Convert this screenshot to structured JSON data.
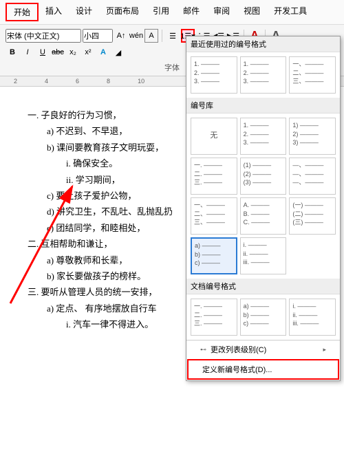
{
  "menubar": {
    "items": [
      "开始",
      "插入",
      "设计",
      "页面布局",
      "引用",
      "邮件",
      "审阅",
      "视图",
      "开发工具"
    ],
    "active_index": 0
  },
  "toolbar": {
    "font_name": "宋体 (中文正文)",
    "font_size": "小四",
    "font_group_label": "字体"
  },
  "ruler": {
    "marks": [
      "2",
      "4",
      "6",
      "8",
      "10"
    ]
  },
  "document": {
    "lines": [
      {
        "level": 1,
        "text": "一. 子良好的行为习惯，"
      },
      {
        "level": 2,
        "text": "a)  不迟到、不早退，"
      },
      {
        "level": 2,
        "text": "b)  课间要教育孩子文明玩耍，"
      },
      {
        "level": 3,
        "text": "i.   确保安全。"
      },
      {
        "level": 3,
        "text": "ii.   学习期间，"
      },
      {
        "level": 2,
        "text": "c)  要让孩子爱护公物，"
      },
      {
        "level": 2,
        "text": "d)  讲究卫生，不乱吐、乱抛乱扔"
      },
      {
        "level": 2,
        "text": "e)  团结同学，和睦相处，"
      },
      {
        "level": 1,
        "text": "二. 互相帮助和谦让，"
      },
      {
        "level": 2,
        "text": "a)  尊敬教师和长辈，"
      },
      {
        "level": 2,
        "text": "b)  家长要做孩子的榜样。"
      },
      {
        "level": 1,
        "text": "三. 要听从管理人员的统一安排，"
      },
      {
        "level": 2,
        "text": "a)  定点、 有序地摆放自行车"
      },
      {
        "level": 3,
        "text": "i.   汽车一律不得进入。"
      }
    ]
  },
  "dropdown": {
    "section_recent": "最近使用过的编号格式",
    "section_library": "编号库",
    "section_doc": "文档编号格式",
    "none_label": "无",
    "previews": {
      "recent": [
        [
          "1. ———",
          "2. ———",
          "3. ———"
        ],
        [
          "1. ———",
          "2. ———",
          "3. ———"
        ],
        [
          "一、———",
          "二、———",
          "三、———"
        ]
      ],
      "library": [
        [
          "",
          "无",
          ""
        ],
        [
          "1. ———",
          "2. ———",
          "3. ———"
        ],
        [
          "1) ———",
          "2) ———",
          "3) ———"
        ],
        [
          "一. ———",
          "二. ———",
          "三. ———"
        ],
        [
          "(1) ———",
          "(2) ———",
          "(3) ———"
        ],
        [
          "—、———",
          "—、———",
          "—、———"
        ],
        [
          "一、———",
          "二、———",
          "三、———"
        ],
        [
          "A. ———",
          "B. ———",
          "C. ———"
        ],
        [
          "(一) ———",
          "(二) ———",
          "(三) ———"
        ],
        [
          "a) ———",
          "b) ———",
          "c) ———"
        ],
        [
          "i. ———",
          "ii. ———",
          "iii. ———"
        ]
      ],
      "doc": [
        [
          "一. ———",
          "二. ———",
          "三. ———"
        ],
        [
          "a) ———",
          "b) ———",
          "c) ———"
        ],
        [
          "i. ———",
          "ii. ———",
          "iii. ———"
        ]
      ],
      "selected_library_index": 9
    },
    "footer": {
      "change_level": "更改列表级别(C)",
      "define_new": "定义新编号格式(D)..."
    }
  }
}
